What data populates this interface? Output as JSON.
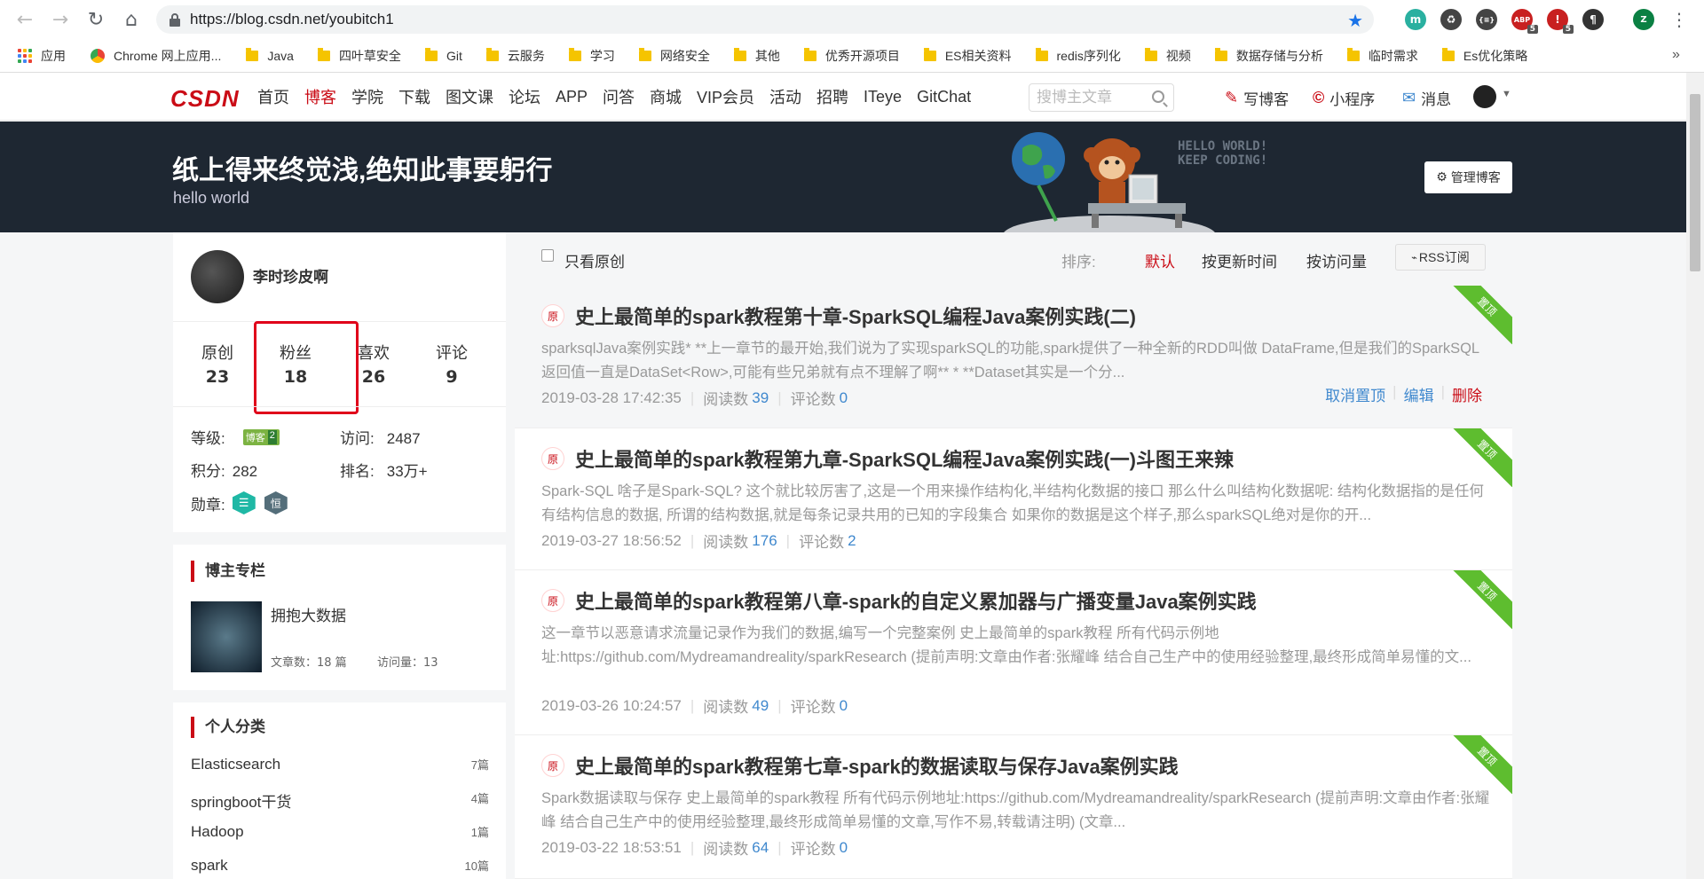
{
  "browser": {
    "url": "https://blog.csdn.net/youbitch1",
    "extensions": [
      {
        "name": "m-icon",
        "label": "m",
        "color": "#2ab0a0"
      },
      {
        "name": "recycle-icon",
        "label": "♻",
        "color": "#444"
      },
      {
        "name": "braces-icon",
        "label": "{≡}",
        "color": "#444"
      },
      {
        "name": "adblock-icon",
        "label": "ABP",
        "color": "#c82020",
        "badge": "5"
      },
      {
        "name": "ublock-icon",
        "label": "!",
        "color": "#c82020",
        "badge": "5"
      },
      {
        "name": "pilcrow-icon",
        "label": "¶",
        "color": "#333"
      }
    ],
    "profile_initial": "Z"
  },
  "bookmarks": [
    {
      "label": "应用",
      "kind": "apps"
    },
    {
      "label": "Chrome 网上应用...",
      "kind": "chrome"
    },
    {
      "label": "Java",
      "kind": "folder"
    },
    {
      "label": "四叶草安全",
      "kind": "folder"
    },
    {
      "label": "Git",
      "kind": "folder"
    },
    {
      "label": "云服务",
      "kind": "folder"
    },
    {
      "label": "学习",
      "kind": "folder"
    },
    {
      "label": "网络安全",
      "kind": "folder"
    },
    {
      "label": "其他",
      "kind": "folder"
    },
    {
      "label": "优秀开源项目",
      "kind": "folder"
    },
    {
      "label": "ES相关资料",
      "kind": "folder"
    },
    {
      "label": "redis序列化",
      "kind": "folder"
    },
    {
      "label": "视频",
      "kind": "folder"
    },
    {
      "label": "数据存储与分析",
      "kind": "folder"
    },
    {
      "label": "临时需求",
      "kind": "folder"
    },
    {
      "label": "Es优化策略",
      "kind": "folder"
    }
  ],
  "csdn": {
    "logo": "CSDN",
    "nav": [
      "首页",
      "博客",
      "学院",
      "下载",
      "图文课",
      "论坛",
      "APP",
      "问答",
      "商城",
      "VIP会员",
      "活动",
      "招聘",
      "ITeye",
      "GitChat"
    ],
    "active_nav": "博客",
    "search_placeholder": "搜博主文章",
    "write": "写博客",
    "miniprogram": "小程序",
    "messages": "消息"
  },
  "banner": {
    "title": "纸上得来终觉浅,绝知此事要躬行",
    "subtitle": "hello world",
    "hello_line1": "HELLO WORLD!",
    "hello_line2": "KEEP CODING!",
    "manage": "管理博客"
  },
  "profile": {
    "name": "李时珍皮啊",
    "stats": [
      {
        "label": "原创",
        "value": "23"
      },
      {
        "label": "粉丝",
        "value": "18"
      },
      {
        "label": "喜欢",
        "value": "26"
      },
      {
        "label": "评论",
        "value": "9"
      }
    ],
    "level_label": "等级:",
    "level_badge": "博客",
    "level_num": "2",
    "visits_label": "访问:",
    "visits": "2487",
    "points_label": "积分:",
    "points": "282",
    "rank_label": "排名:",
    "rank": "33万+",
    "medal_label": "勋章:"
  },
  "column": {
    "title": "博主专栏",
    "name": "拥抱大数据",
    "articles": "文章数：18 篇",
    "views": "访问量：13"
  },
  "categories": {
    "title": "个人分类",
    "items": [
      {
        "name": "Elasticsearch",
        "count": "7篇"
      },
      {
        "name": "springboot干货",
        "count": "4篇"
      },
      {
        "name": "Hadoop",
        "count": "1篇"
      },
      {
        "name": "spark",
        "count": "10篇"
      }
    ]
  },
  "filter": {
    "original_only": "只看原创",
    "sort_label": "排序:",
    "default": "默认",
    "by_update": "按更新时间",
    "by_visits": "按访问量",
    "rss": "RSS订阅"
  },
  "articles": [
    {
      "tag": "原",
      "title": "史上最简单的spark教程第十章-SparkSQL编程Java案例实践(二)",
      "desc": "sparksqlJava案例实践* **上一章节的最开始,我们说为了实现sparkSQL的功能,spark提供了一种全新的RDD叫做 DataFrame,但是我们的SparkSQL返回值一直是DataSet<Row>,可能有些兄弟就有点不理解了啊** * **Dataset其实是一个分...",
      "date": "2019-03-28 17:42:35",
      "reads_label": "阅读数",
      "reads": "39",
      "comments_label": "评论数",
      "comments": "0",
      "pinned": "置顶",
      "ops": [
        "取消置顶",
        "编辑",
        "删除"
      ]
    },
    {
      "tag": "原",
      "title": "史上最简单的spark教程第九章-SparkSQL编程Java案例实践(一)斗图王来辣",
      "desc": "Spark-SQL 啥子是Spark-SQL? 这个就比较厉害了,这是一个用来操作结构化,半结构化数据的接口 那么什么叫结构化数据呢: 结构化数据指的是任何有结构信息的数据, 所谓的结构数据,就是每条记录共用的已知的字段集合 如果你的数据是这个样子,那么sparkSQL绝对是你的开...",
      "date": "2019-03-27 18:56:52",
      "reads_label": "阅读数",
      "reads": "176",
      "comments_label": "评论数",
      "comments": "2",
      "pinned": "置顶"
    },
    {
      "tag": "原",
      "title": "史上最简单的spark教程第八章-spark的自定义累加器与广播变量Java案例实践",
      "desc": "这一章节以恶意请求流量记录作为我们的数据,编写一个完整案例 史上最简单的spark教程 所有代码示例地址:https://github.com/Mydreamandreality/sparkResearch (提前声明:文章由作者:张耀峰 结合自己生产中的使用经验整理,最终形成简单易懂的文...",
      "date": "2019-03-26 10:24:57",
      "reads_label": "阅读数",
      "reads": "49",
      "comments_label": "评论数",
      "comments": "0",
      "pinned": "置顶"
    },
    {
      "tag": "原",
      "title": "史上最简单的spark教程第七章-spark的数据读取与保存Java案例实践",
      "desc": "Spark数据读取与保存 史上最简单的spark教程 所有代码示例地址:https://github.com/Mydreamandreality/sparkResearch (提前声明:文章由作者:张耀峰 结合自己生产中的使用经验整理,最终形成简单易懂的文章,写作不易,转载请注明) (文章...",
      "date": "2019-03-22 18:53:51",
      "reads_label": "阅读数",
      "reads": "64",
      "comments_label": "评论数",
      "comments": "0",
      "pinned": "置顶"
    }
  ],
  "colors": {
    "accent": "#ca0c16",
    "link": "#3f88ce",
    "pin": "#5ebd2f",
    "banner": "#1e2732",
    "highlight_box": "#e0001a"
  }
}
